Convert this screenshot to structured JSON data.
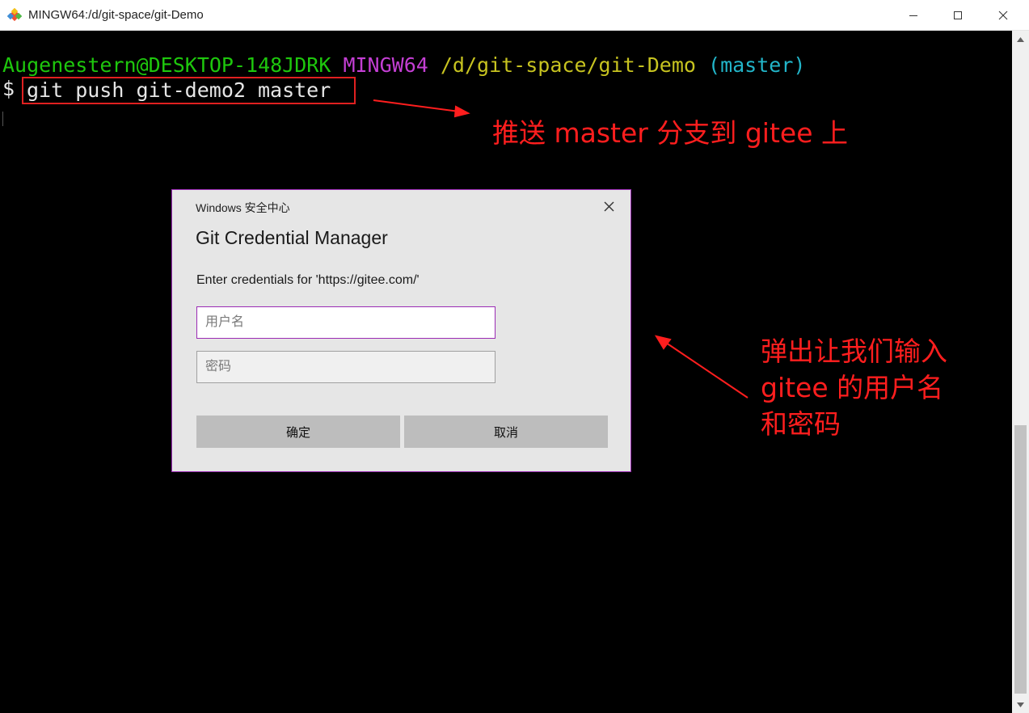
{
  "window": {
    "title": "MINGW64:/d/git-space/git-Demo"
  },
  "terminal": {
    "prompt_user": "Augenestern@DESKTOP-148JDRK",
    "prompt_env": "MINGW64",
    "prompt_path": "/d/git-space/git-Demo",
    "prompt_branch": "(master)",
    "dollar": "$",
    "command": "git push git-demo2 master"
  },
  "annotations": {
    "top": "推送 master 分支到 gitee 上",
    "right_lines": [
      "弹出让我们输入",
      "gitee 的用户名",
      "和密码"
    ],
    "color": "#ff1e1e"
  },
  "dialog": {
    "source": "Windows 安全中心",
    "title": "Git Credential Manager",
    "description": "Enter credentials for 'https://gitee.com/'",
    "username_placeholder": "用户名",
    "password_placeholder": "密码",
    "ok_label": "确定",
    "cancel_label": "取消",
    "accent": "#9b2bb4"
  },
  "icons": {
    "app": "git-logo-icon",
    "minimize": "minimize-icon",
    "maximize": "maximize-icon",
    "close": "close-icon"
  }
}
